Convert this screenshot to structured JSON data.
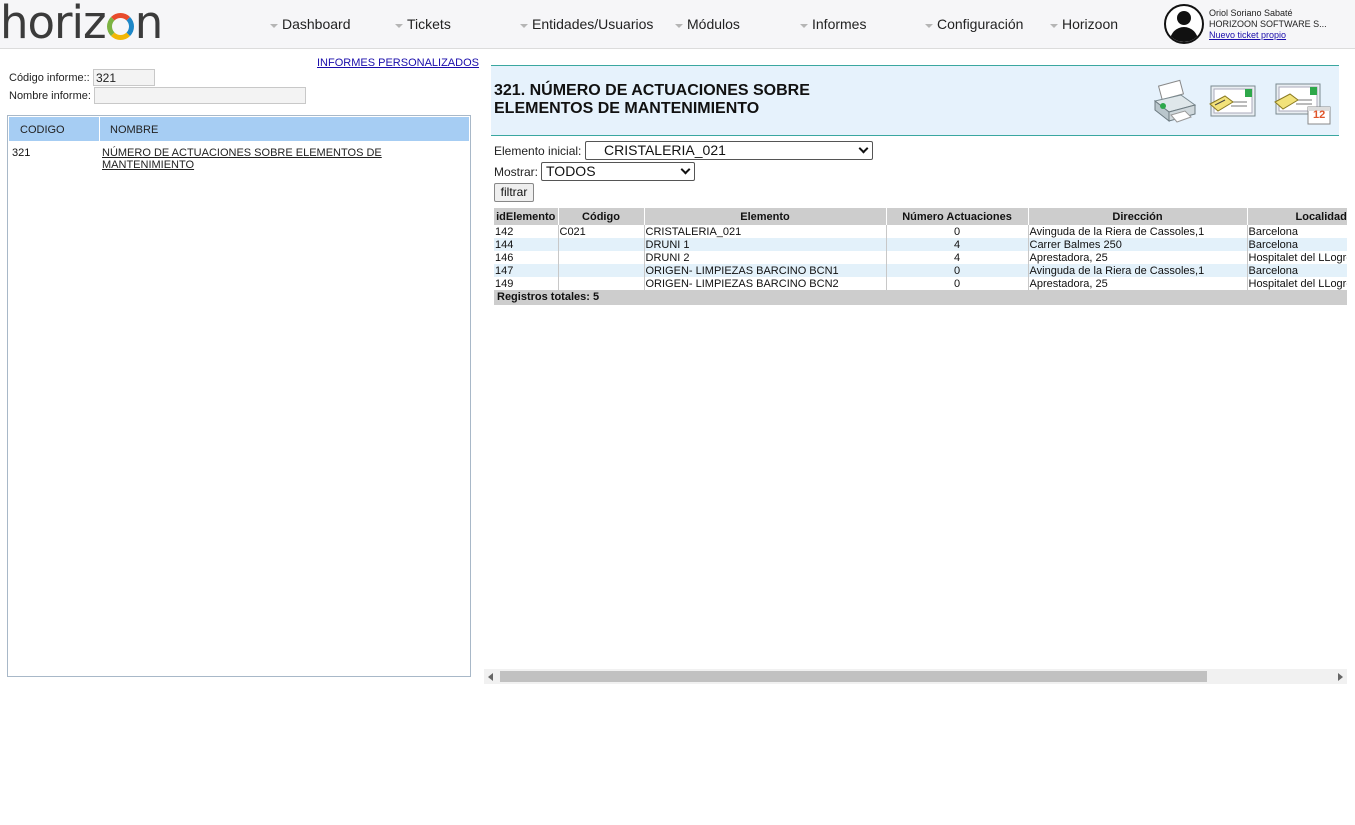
{
  "brand": {
    "logo_text_before": "horiz",
    "logo_text_after": "n"
  },
  "nav": {
    "items": [
      {
        "label": "Dashboard"
      },
      {
        "label": "Tickets"
      },
      {
        "label": "Entidades/Usuarios"
      },
      {
        "label": "Módulos"
      },
      {
        "label": "Informes"
      },
      {
        "label": "Configuración"
      },
      {
        "label": "Horizoon"
      }
    ]
  },
  "user": {
    "name": "Oriol Soriano Sabaté",
    "company": "HORIZOON SOFTWARE S...",
    "new_ticket_link": "Nuevo ticket propio"
  },
  "left": {
    "link_personalizados": "INFORMES PERSONALIZADOS",
    "code_label": "Código informe::",
    "code_value": "321",
    "name_label": "Nombre informe:",
    "name_value": "",
    "list_headers": {
      "code": "CODIGO",
      "name": "NOMBRE"
    },
    "rows": [
      {
        "code": "321",
        "name": "NÚMERO DE ACTUACIONES SOBRE ELEMENTOS DE MANTENIMIENTO"
      }
    ]
  },
  "report": {
    "title_line1": "321. NÚMERO DE ACTUACIONES SOBRE",
    "title_line2": "ELEMENTOS DE MANTENIMIENTO",
    "icons": [
      "printer-icon",
      "email-icon",
      "scheduled-email-icon"
    ],
    "scheduled_badge": "12",
    "filters": {
      "elemento_label": "Elemento inicial:",
      "elemento_value": "CRISTALERIA_021",
      "mostrar_label": "Mostrar:",
      "mostrar_value": "TODOS",
      "button_label": "filtrar"
    },
    "table": {
      "headers": [
        "idElemento",
        "Código",
        "Elemento",
        "Número Actuaciones",
        "Dirección",
        "Localidad"
      ],
      "rows": [
        [
          "142",
          "C021",
          "CRISTALERIA_021",
          "0",
          "Avinguda de la Riera de Cassoles,1",
          "Barcelona"
        ],
        [
          "144",
          "",
          "DRUNI 1",
          "4",
          "Carrer Balmes 250",
          "Barcelona"
        ],
        [
          "146",
          "",
          "DRUNI 2",
          "4",
          "Aprestadora, 25",
          "Hospitalet del LLogregat"
        ],
        [
          "147",
          "",
          "ORIGEN- LIMPIEZAS BARCINO BCN1",
          "0",
          "Avinguda de la Riera de Cassoles,1",
          "Barcelona"
        ],
        [
          "149",
          "",
          "ORIGEN- LIMPIEZAS BARCINO BCN2",
          "0",
          "Aprestadora, 25",
          "Hospitalet del LLogregat"
        ]
      ],
      "totals": "Registros totales: 5"
    }
  }
}
